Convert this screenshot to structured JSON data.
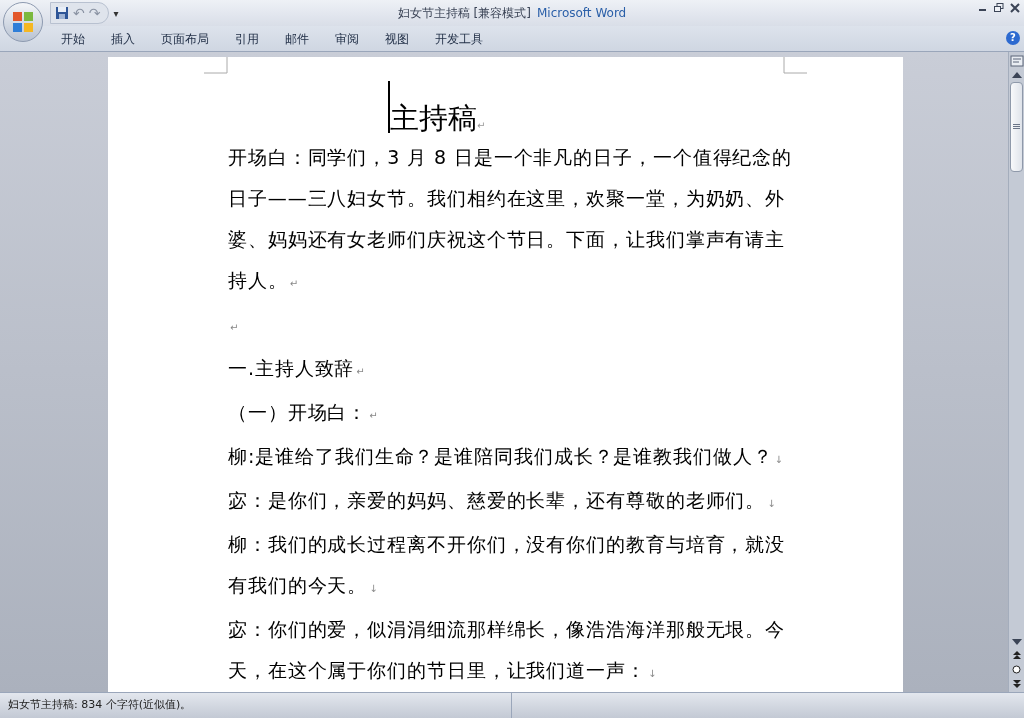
{
  "window": {
    "title": "妇女节主持稿 [兼容模式]",
    "app": "Microsoft Word"
  },
  "help": "?",
  "quick_access": {
    "undo": "↶",
    "redo": "↷",
    "customize": "▾"
  },
  "tabs": [
    {
      "label": "开始",
      "selected": false
    },
    {
      "label": "插入",
      "selected": false
    },
    {
      "label": "页面布局",
      "selected": false
    },
    {
      "label": "引用",
      "selected": false
    },
    {
      "label": "邮件",
      "selected": false
    },
    {
      "label": "审阅",
      "selected": false
    },
    {
      "label": "视图",
      "selected": false
    },
    {
      "label": "开发工具",
      "selected": false
    }
  ],
  "document": {
    "title": "主持稿",
    "title_mark": "↵",
    "paragraphs": [
      {
        "kind": "body",
        "text": "开场白：同学们，3 月 8 日是一个非凡的日子，一个值得纪念的日子——三八妇女节。我们相约在这里，欢聚一堂，为奶奶、外婆、妈妈还有女老师们庆祝这个节日。下面，让我们掌声有请主持人。",
        "mark": "↵"
      },
      {
        "kind": "body",
        "mark": "↵"
      },
      {
        "kind": "body",
        "text": "一.主持人致辞",
        "mark": "↵"
      },
      {
        "kind": "body",
        "text": "（一）开场白：",
        "mark": "↵"
      },
      {
        "kind": "body",
        "text": "柳:是谁给了我们生命？是谁陪同我们成长？是谁教我们做人？",
        "mark": "↓"
      },
      {
        "kind": "body",
        "text": "宓：是你们，亲爱的妈妈、慈爱的长辈，还有尊敬的老师们。",
        "mark": "↓"
      },
      {
        "kind": "body",
        "text": "柳：我们的成长过程离不开你们，没有你们的教育与培育，就没有我们的今天。",
        "mark": "↓"
      },
      {
        "kind": "body",
        "text": "宓：你们的爱，似涓涓细流那样绵长，像浩浩海洋那般无垠。今天，在这个属于你们的节日里，让我们道一声：",
        "mark": "↓"
      }
    ]
  },
  "status_bar": {
    "text": "妇女节主持稿: 834 个字符(近似值)。"
  }
}
